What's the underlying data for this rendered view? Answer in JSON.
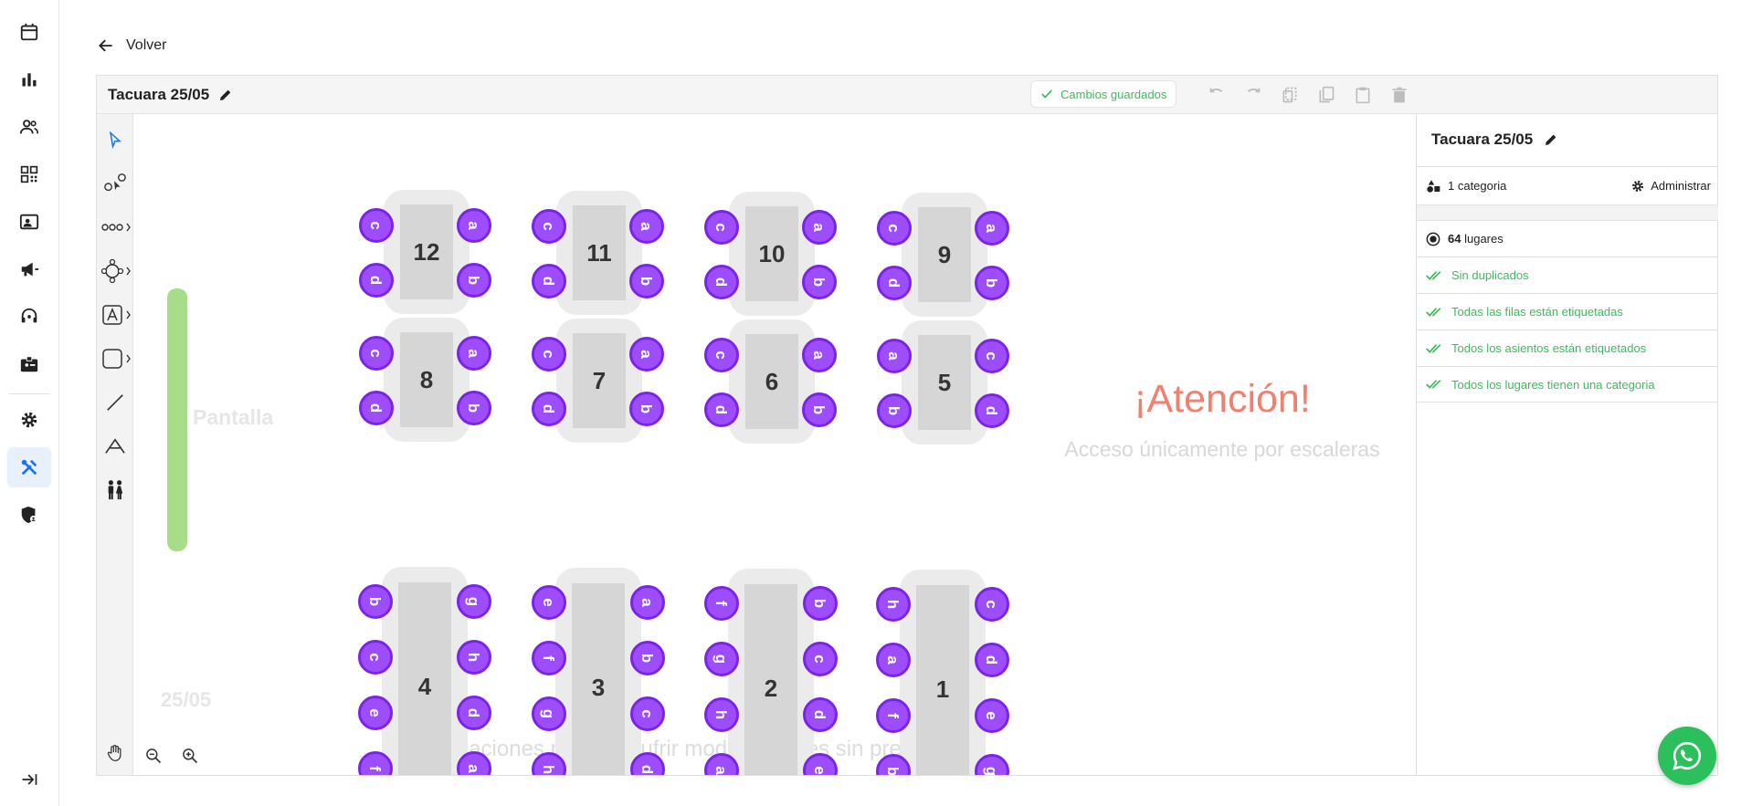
{
  "nav": {
    "items": [
      {
        "icon": "calendar-icon"
      },
      {
        "icon": "bar-chart-icon"
      },
      {
        "icon": "people-icon"
      },
      {
        "icon": "qr-code-icon"
      },
      {
        "icon": "contact-card-icon"
      },
      {
        "icon": "megaphone-icon"
      },
      {
        "icon": "support-agent-icon"
      },
      {
        "icon": "badge-icon"
      },
      {
        "icon": "gear-icon"
      },
      {
        "icon": "tools-icon",
        "active": true
      },
      {
        "icon": "security-icon"
      }
    ],
    "collapse_icon": "collapse-icon"
  },
  "back_label": "Volver",
  "editor": {
    "title": "Tacuara 25/05",
    "saved_label": "Cambios guardados",
    "header_buttons": [
      "undo-icon",
      "redo-icon",
      "duplicate-icon",
      "copy-icon",
      "paste-icon",
      "delete-icon"
    ]
  },
  "canvas": {
    "screen_label": "Pantalla",
    "date_label": "25/05",
    "warning_title": "¡Atención!",
    "warning_text": "Acceso únicamente por escaleras",
    "footer_note": "Las ubicaciones pueden sufrir modificaciones sin previo aviso",
    "tables_top": [
      {
        "number": "12",
        "seats": [
          "c",
          "a",
          "d",
          "b"
        ]
      },
      {
        "number": "11",
        "seats": [
          "c",
          "a",
          "d",
          "b"
        ]
      },
      {
        "number": "10",
        "seats": [
          "c",
          "a",
          "d",
          "b"
        ]
      },
      {
        "number": "9",
        "seats": [
          "c",
          "a",
          "d",
          "b"
        ]
      },
      {
        "number": "8",
        "seats": [
          "c",
          "a",
          "d",
          "b"
        ]
      },
      {
        "number": "7",
        "seats": [
          "c",
          "a",
          "d",
          "b"
        ]
      },
      {
        "number": "6",
        "seats": [
          "c",
          "a",
          "d",
          "b"
        ]
      },
      {
        "number": "5",
        "seats": [
          "a",
          "c",
          "b",
          "d"
        ]
      }
    ],
    "tables_bottom": [
      {
        "number": "4",
        "left": [
          "b",
          "c",
          "e",
          "f"
        ],
        "right": [
          "g",
          "h",
          "d",
          "a"
        ]
      },
      {
        "number": "3",
        "left": [
          "e",
          "f",
          "g",
          "h"
        ],
        "right": [
          "a",
          "b",
          "c",
          "d"
        ]
      },
      {
        "number": "2",
        "left": [
          "f",
          "g",
          "h",
          "a"
        ],
        "right": [
          "b",
          "c",
          "d",
          "e"
        ]
      },
      {
        "number": "1",
        "left": [
          "h",
          "a",
          "f",
          "b"
        ],
        "right": [
          "c",
          "d",
          "e",
          "g"
        ]
      }
    ]
  },
  "sidepanel": {
    "title": "Tacuara 25/05",
    "category_label": "1 categoria",
    "manage_label": "Administrar",
    "places_count": "64",
    "places_label": "lugares",
    "checks": [
      "Sin duplicados",
      "Todas las filas están etiquetadas",
      "Todos los asientos están etiquetados",
      "Todos los lugares tienen una categoria"
    ]
  },
  "colors": {
    "seat": "#9d4dfb",
    "seat_ring": "#7b24e8",
    "table": "#d6d6d6",
    "table_bg": "#ebebeb",
    "screen": "#a7dd88",
    "warning": "#f08070",
    "ok_green": "#3dbb5c",
    "whatsapp": "#2cc05c"
  }
}
